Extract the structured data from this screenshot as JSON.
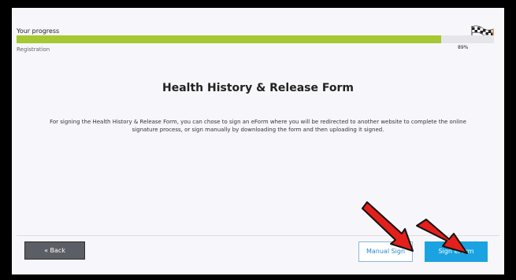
{
  "progress": {
    "title": "Your progress",
    "percent_text": "89%",
    "fraction": 0.89,
    "stage_label": "Registration",
    "fill_color": "#a6c832"
  },
  "form": {
    "title": "Health History & Release Form",
    "description": "For signing the Health History & Release Form, you can chose to sign an eForm where you will be redirected to another website to complete the online signature process, or sign manually by downloading the form and then uploading it signed."
  },
  "buttons": {
    "back_label": "« Back",
    "manual_label": "Manual Sign",
    "eform_label": "Sign eForm"
  },
  "icons": {
    "flag": "checkered-flag-icon",
    "annotation": "red-arrow-icon"
  },
  "colors": {
    "accent": "#1aa3e0",
    "annotation": "#e3201b"
  }
}
